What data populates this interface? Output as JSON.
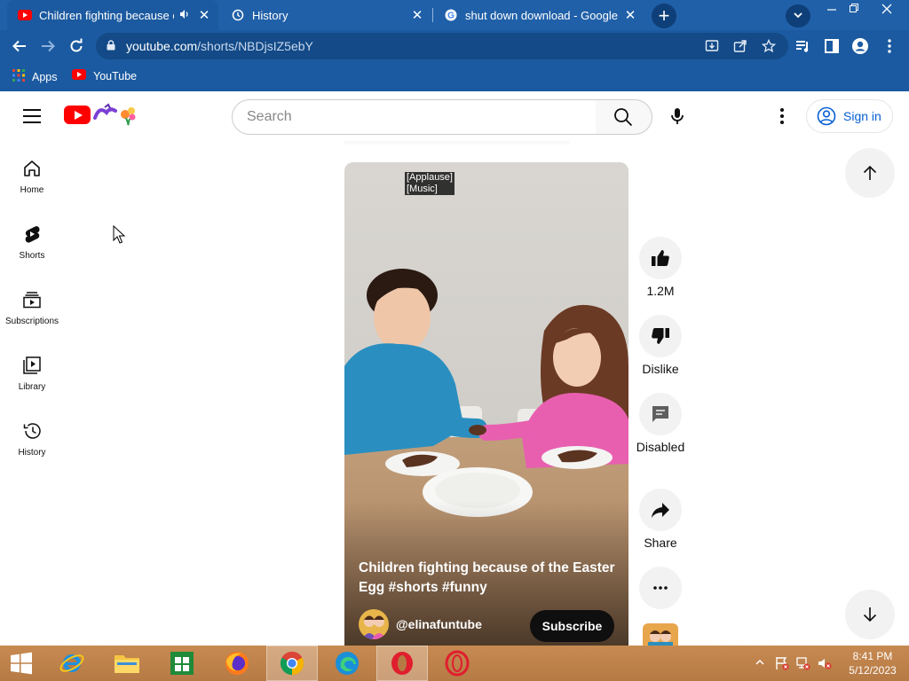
{
  "browser": {
    "tabs": [
      {
        "title": "Children fighting because of",
        "favicon": "youtube-icon",
        "audio": true,
        "active": true
      },
      {
        "title": "History",
        "favicon": "history-icon",
        "active": false
      },
      {
        "title": "shut down download - Google Se",
        "favicon": "google-icon",
        "active": false
      }
    ],
    "close_glyph": "✕",
    "new_tab_glyph": "+",
    "url_host": "youtube.com",
    "url_path": "/shorts/NBDjsIZ5ebY",
    "bookmarks": [
      {
        "label": "Apps",
        "icon": "apps-grid-icon"
      },
      {
        "label": "YouTube",
        "icon": "youtube-icon"
      }
    ]
  },
  "youtube": {
    "search_placeholder": "Search",
    "sign_in_label": "Sign in",
    "nav": [
      {
        "label": "Home",
        "icon": "home-icon"
      },
      {
        "label": "Shorts",
        "icon": "shorts-icon"
      },
      {
        "label": "Subscriptions",
        "icon": "subscriptions-icon"
      },
      {
        "label": "Library",
        "icon": "library-icon"
      },
      {
        "label": "History",
        "icon": "history-icon"
      }
    ],
    "short": {
      "caption_line1": "[Applause]",
      "caption_line2": "[Music]",
      "title": "Children fighting because of the Easter Egg #shorts #funny",
      "channel": "@elinafuntube",
      "subscribe_label": "Subscribe"
    },
    "actions": {
      "likes": "1.2M",
      "dislike": "Dislike",
      "comments": "Disabled",
      "share": "Share"
    }
  },
  "taskbar": {
    "apps": [
      "start",
      "internet-explorer",
      "file-explorer",
      "store",
      "firefox",
      "chrome",
      "edge",
      "opera",
      "opera-gx"
    ],
    "active_app": "chrome",
    "time": "8:41 PM",
    "date": "5/12/2023"
  },
  "colors": {
    "browser_frame": "#1b5aa0",
    "youtube_red": "#ff0000",
    "link_blue": "#065fd4",
    "taskbar": "#c78a51"
  }
}
